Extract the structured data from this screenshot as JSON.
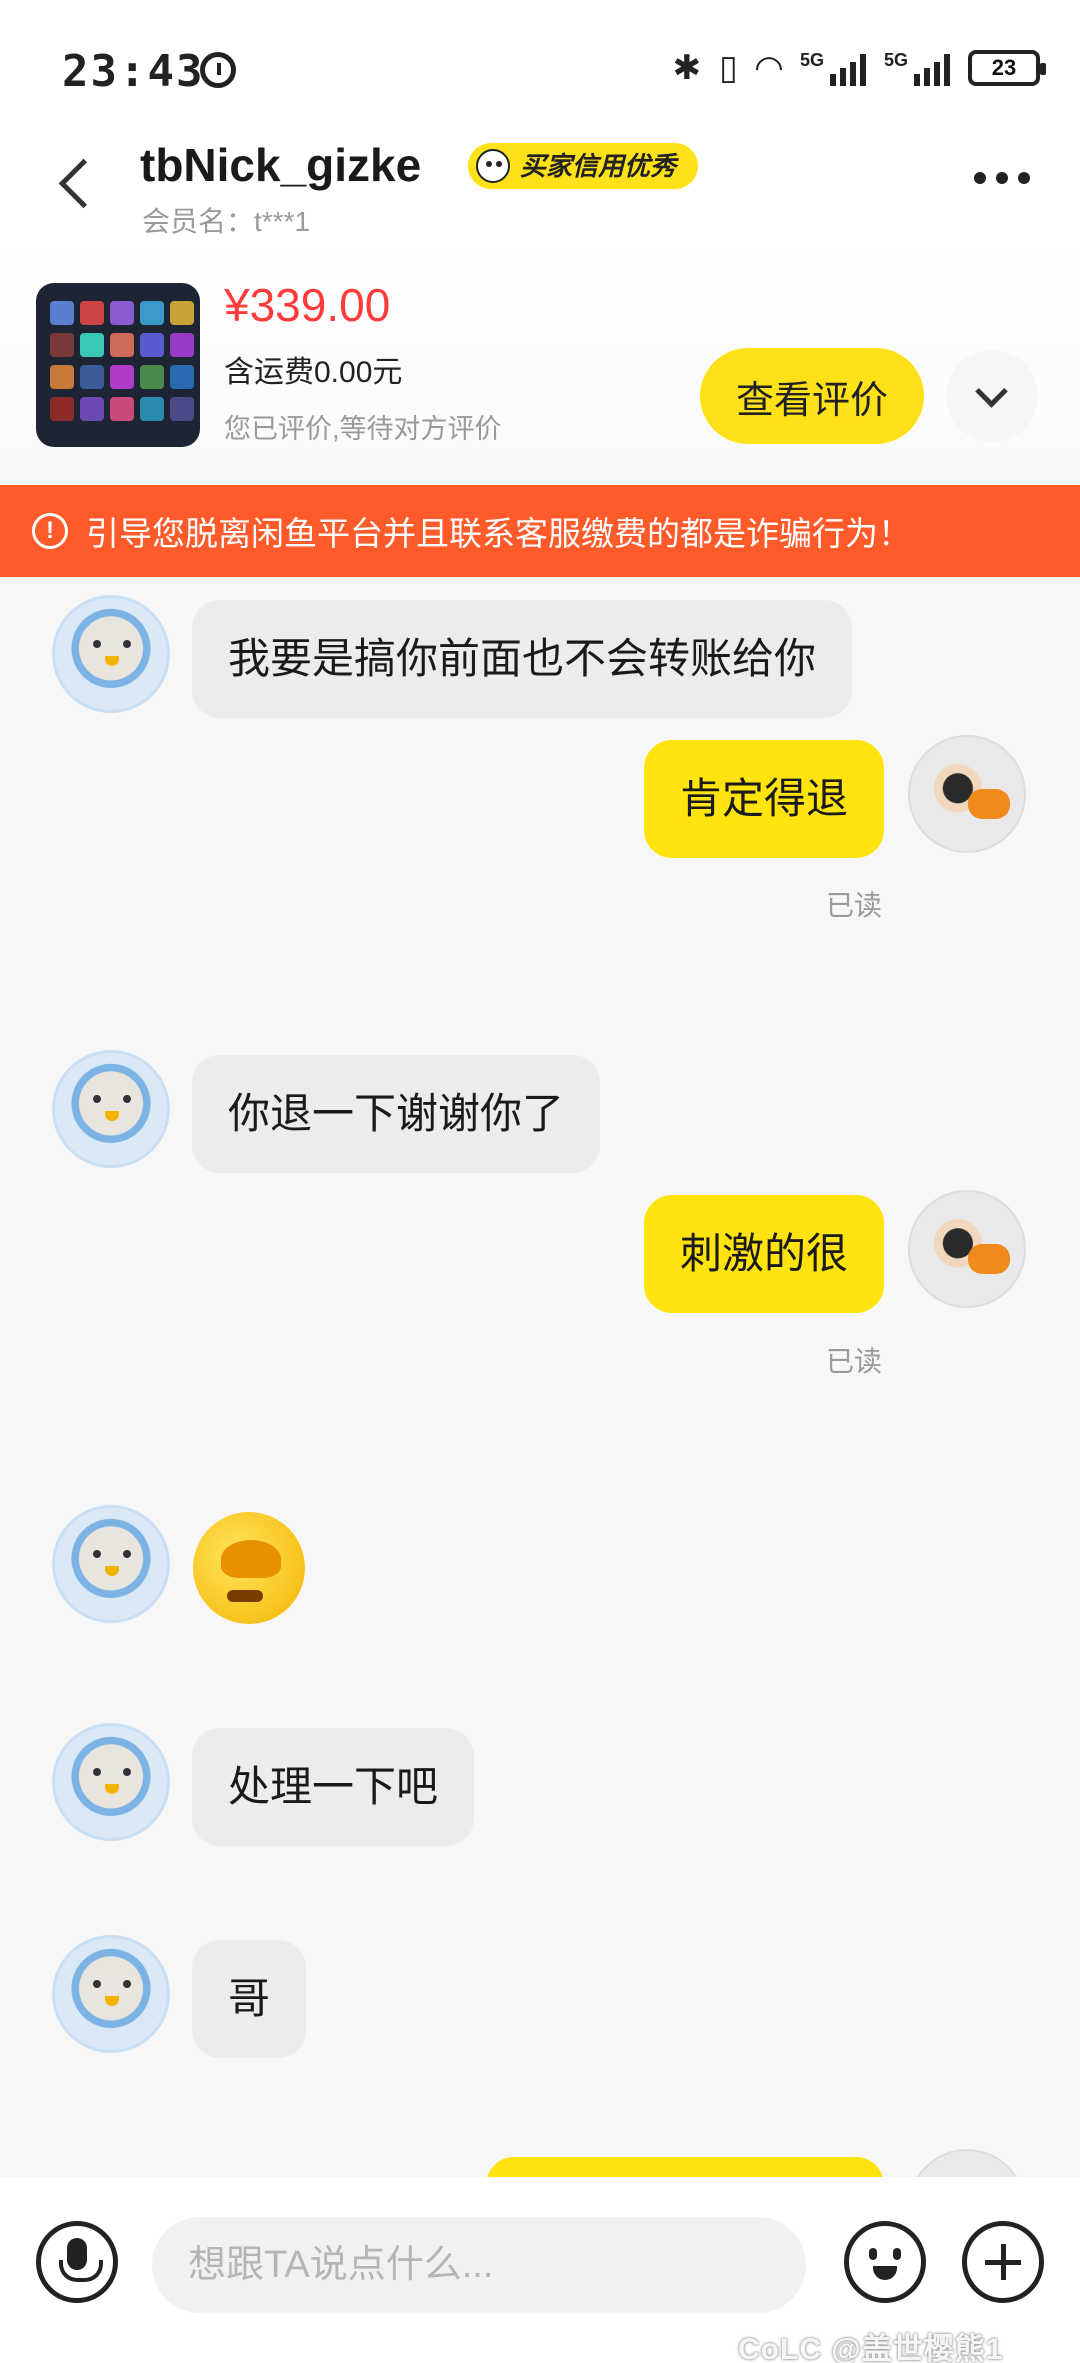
{
  "status_bar": {
    "time": "23:43",
    "battery": "23",
    "icons": [
      "alarm-icon",
      "bluetooth-icon",
      "vibrate-icon",
      "wifi-icon",
      "signal-5g-icon",
      "signal-5g-icon",
      "battery-icon"
    ],
    "network_label_1": "5G",
    "network_label_2": "5G"
  },
  "header": {
    "nickname": "tbNick_gizke",
    "badge": "买家信用优秀",
    "member_name": "会员名：t***1"
  },
  "product": {
    "price": "¥339.00",
    "shipping": "含运费0.00元",
    "status": "您已评价,等待对方评价",
    "review_button": "查看评价"
  },
  "warning": {
    "text": "引导您脱离闲鱼平台并且联系客服缴费的都是诈骗行为！"
  },
  "messages": [
    {
      "side": "left",
      "text": "我要是搞你前面也不会转账给你"
    },
    {
      "side": "right",
      "text": "肯定得退",
      "status": "已读"
    },
    {
      "side": "left",
      "text": "你退一下谢谢你了"
    },
    {
      "side": "right",
      "text": "刺激的很",
      "status": "已读"
    },
    {
      "side": "left",
      "type": "emoji",
      "emoji": "facepalm-cry-emoji"
    },
    {
      "side": "left",
      "text": "处理一下吧"
    },
    {
      "side": "left",
      "text": "哥"
    }
  ],
  "input": {
    "placeholder": "想跟TA说点什么..."
  },
  "watermark": "CoLC @盖世樱熊1",
  "colors": {
    "accent_yellow": "#ffe30f",
    "warning_orange": "#ff5a2a",
    "price_red": "#ff3b3b"
  }
}
